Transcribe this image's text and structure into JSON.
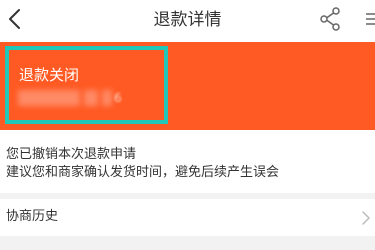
{
  "nav": {
    "title": "退款详情",
    "back_icon": "chevron-left-icon",
    "share_icon": "share-icon",
    "more_icon": "more-icon"
  },
  "status": {
    "title": "退款关闭",
    "redacted_suffix": "6",
    "banner_color": "#ff5a23",
    "highlight_color": "#22c7b8"
  },
  "message": {
    "line1": "您已撤销本次退款申请",
    "line2": "建议您和商家确认发货时间，避免后续产生误会"
  },
  "history": {
    "label": "协商历史",
    "chevron_icon": "chevron-right-icon"
  }
}
